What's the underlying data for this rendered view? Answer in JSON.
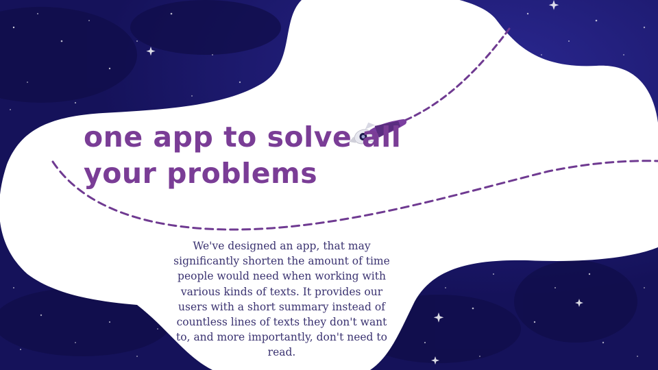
{
  "slide": {
    "title_line_1": "One app to solve all",
    "title_line_2": "your problems",
    "body": "We've designed an app, that may significantly shorten the amount of time people would need when working with various kinds of texts. It provides our users with a short summary instead of countless lines of texts they don't want to, and more importantly, don't need to read."
  },
  "icons": {
    "rocket": "rocket-icon",
    "stars": "sparkle-star-icon"
  },
  "colors": {
    "background": "#15125a",
    "background_light": "#2a2790",
    "blob": "#ffffff",
    "title": "#7a3d96",
    "body_text": "#3a3270",
    "dashed_path": "#6f3a91",
    "rocket_body": "#7b3fa0",
    "rocket_window": "#1d1a4a"
  }
}
